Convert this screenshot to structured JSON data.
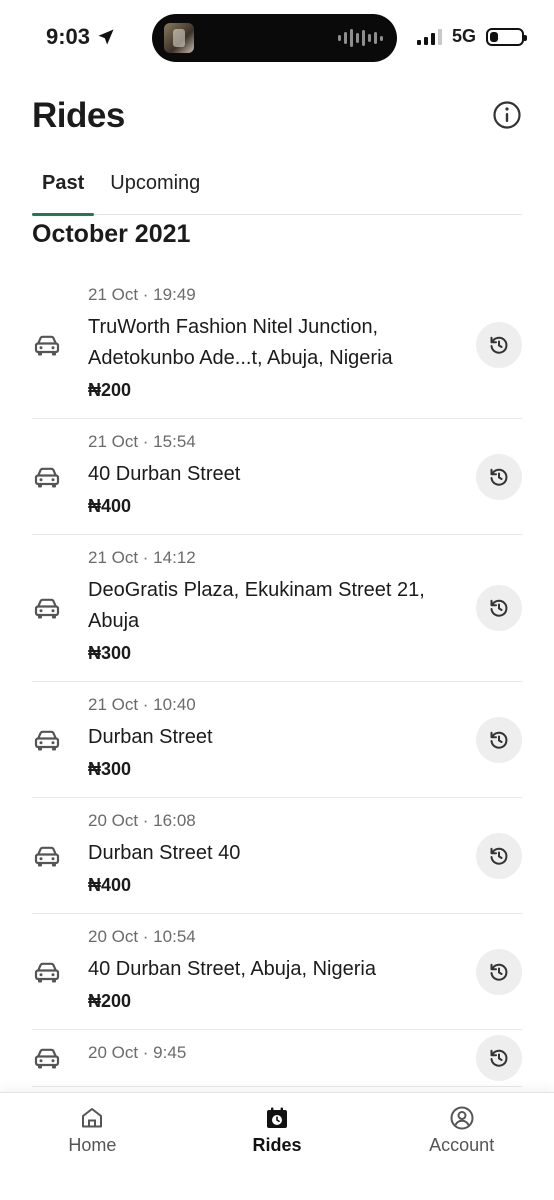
{
  "status_bar": {
    "time": "9:03",
    "network": "5G"
  },
  "header": {
    "title": "Rides"
  },
  "tabs": [
    {
      "label": "Past",
      "active": true
    },
    {
      "label": "Upcoming",
      "active": false
    }
  ],
  "month": "October 2021",
  "rides": [
    {
      "date": "21 Oct · 19:49",
      "address": "TruWorth Fashion Nitel Junction, Adetokunbo Ade...t, Abuja, Nigeria",
      "price": "₦200"
    },
    {
      "date": "21 Oct · 15:54",
      "address": "40 Durban Street",
      "price": "₦400"
    },
    {
      "date": "21 Oct · 14:12",
      "address": "DeoGratis Plaza, Ekukinam Street 21, Abuja",
      "price": "₦300"
    },
    {
      "date": "21 Oct · 10:40",
      "address": "Durban Street",
      "price": "₦300"
    },
    {
      "date": "20 Oct · 16:08",
      "address": "Durban Street 40",
      "price": "₦400"
    },
    {
      "date": "20 Oct · 10:54",
      "address": "40 Durban Street, Abuja, Nigeria",
      "price": "₦200"
    },
    {
      "date": "20 Oct · 9:45",
      "address": "",
      "price": ""
    }
  ],
  "bottom_nav": [
    {
      "label": "Home",
      "icon": "home-icon",
      "active": false
    },
    {
      "label": "Rides",
      "icon": "rides-calendar-icon",
      "active": true
    },
    {
      "label": "Account",
      "icon": "account-icon",
      "active": false
    }
  ],
  "colors": {
    "accent": "#1f7a4d",
    "rebook_bg": "#eeeeee",
    "muted_text": "#6b6b6b"
  }
}
